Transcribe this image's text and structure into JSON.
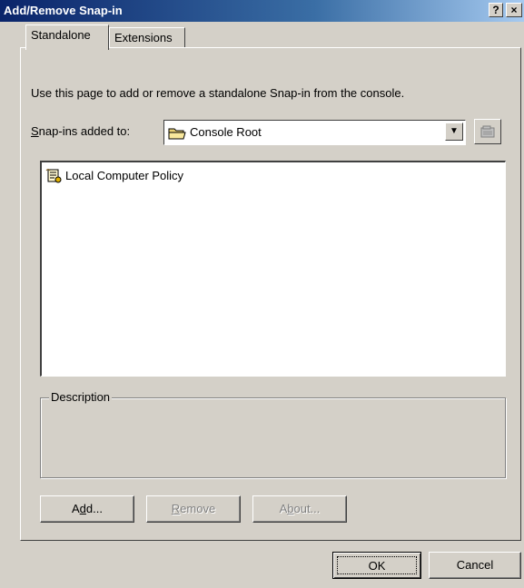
{
  "window": {
    "title": "Add/Remove Snap-in",
    "help_label": "?",
    "close_label": "×"
  },
  "tabs": [
    {
      "label": "Standalone",
      "active": true
    },
    {
      "label": "Extensions",
      "active": false
    }
  ],
  "intro_text": "Use this page to add or remove a standalone Snap-in from the console.",
  "snapins_label": {
    "accel": "S",
    "rest": "nap-ins added to:"
  },
  "combo": {
    "value": "Console Root",
    "arrow": "▼",
    "icon": "folder-icon"
  },
  "list": {
    "items": [
      {
        "label": "Local Computer Policy",
        "icon": "policy-scroll-icon"
      }
    ]
  },
  "description": {
    "legend": "Description",
    "text": ""
  },
  "buttons": {
    "add": {
      "pre": "A",
      "accel": "d",
      "post": "d..."
    },
    "remove": {
      "pre": "",
      "accel": "R",
      "post": "emove"
    },
    "about": {
      "pre": "A",
      "accel": "b",
      "post": "out..."
    },
    "ok": "OK",
    "cancel": "Cancel"
  },
  "colors": {
    "face": "#d4d0c8",
    "title_start": "#0a246a",
    "title_end": "#a6caf0",
    "disabled_text": "#808080"
  }
}
